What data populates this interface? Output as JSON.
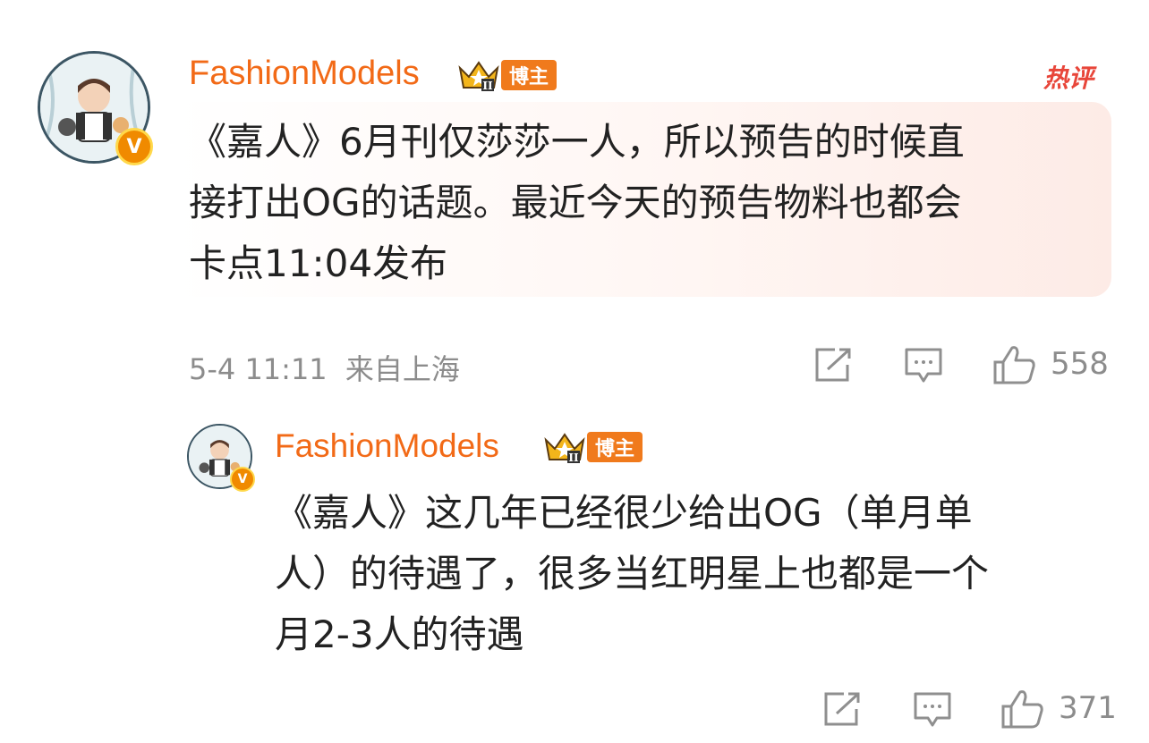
{
  "comment": {
    "username": "FashionModels",
    "role": "博主",
    "hot_tag": "热评",
    "text_lines": [
      "《嘉人》6月刊仅莎莎一人，所以预告的时候直",
      "接打出OG的话题。最近今天的预告物料也都会",
      "卡点11:04发布"
    ],
    "time": "5-4 11:11",
    "location": "来自上海",
    "likes": "558",
    "icons": [
      "share-icon",
      "comment-icon",
      "like-icon"
    ]
  },
  "reply": {
    "username": "FashionModels",
    "role": "博主",
    "text_lines": [
      "《嘉人》这几年已经很少给出OG（单月单",
      "人）的待遇了，很多当红明星上也都是一个",
      "月2-3人的待遇"
    ],
    "likes": "371",
    "icons": [
      "share-icon",
      "comment-icon",
      "like-icon"
    ]
  },
  "colors": {
    "accent": "#f26a17",
    "role_tag": "#f07a1c",
    "hot": "#e8463a",
    "meta": "#8c8c8c"
  }
}
